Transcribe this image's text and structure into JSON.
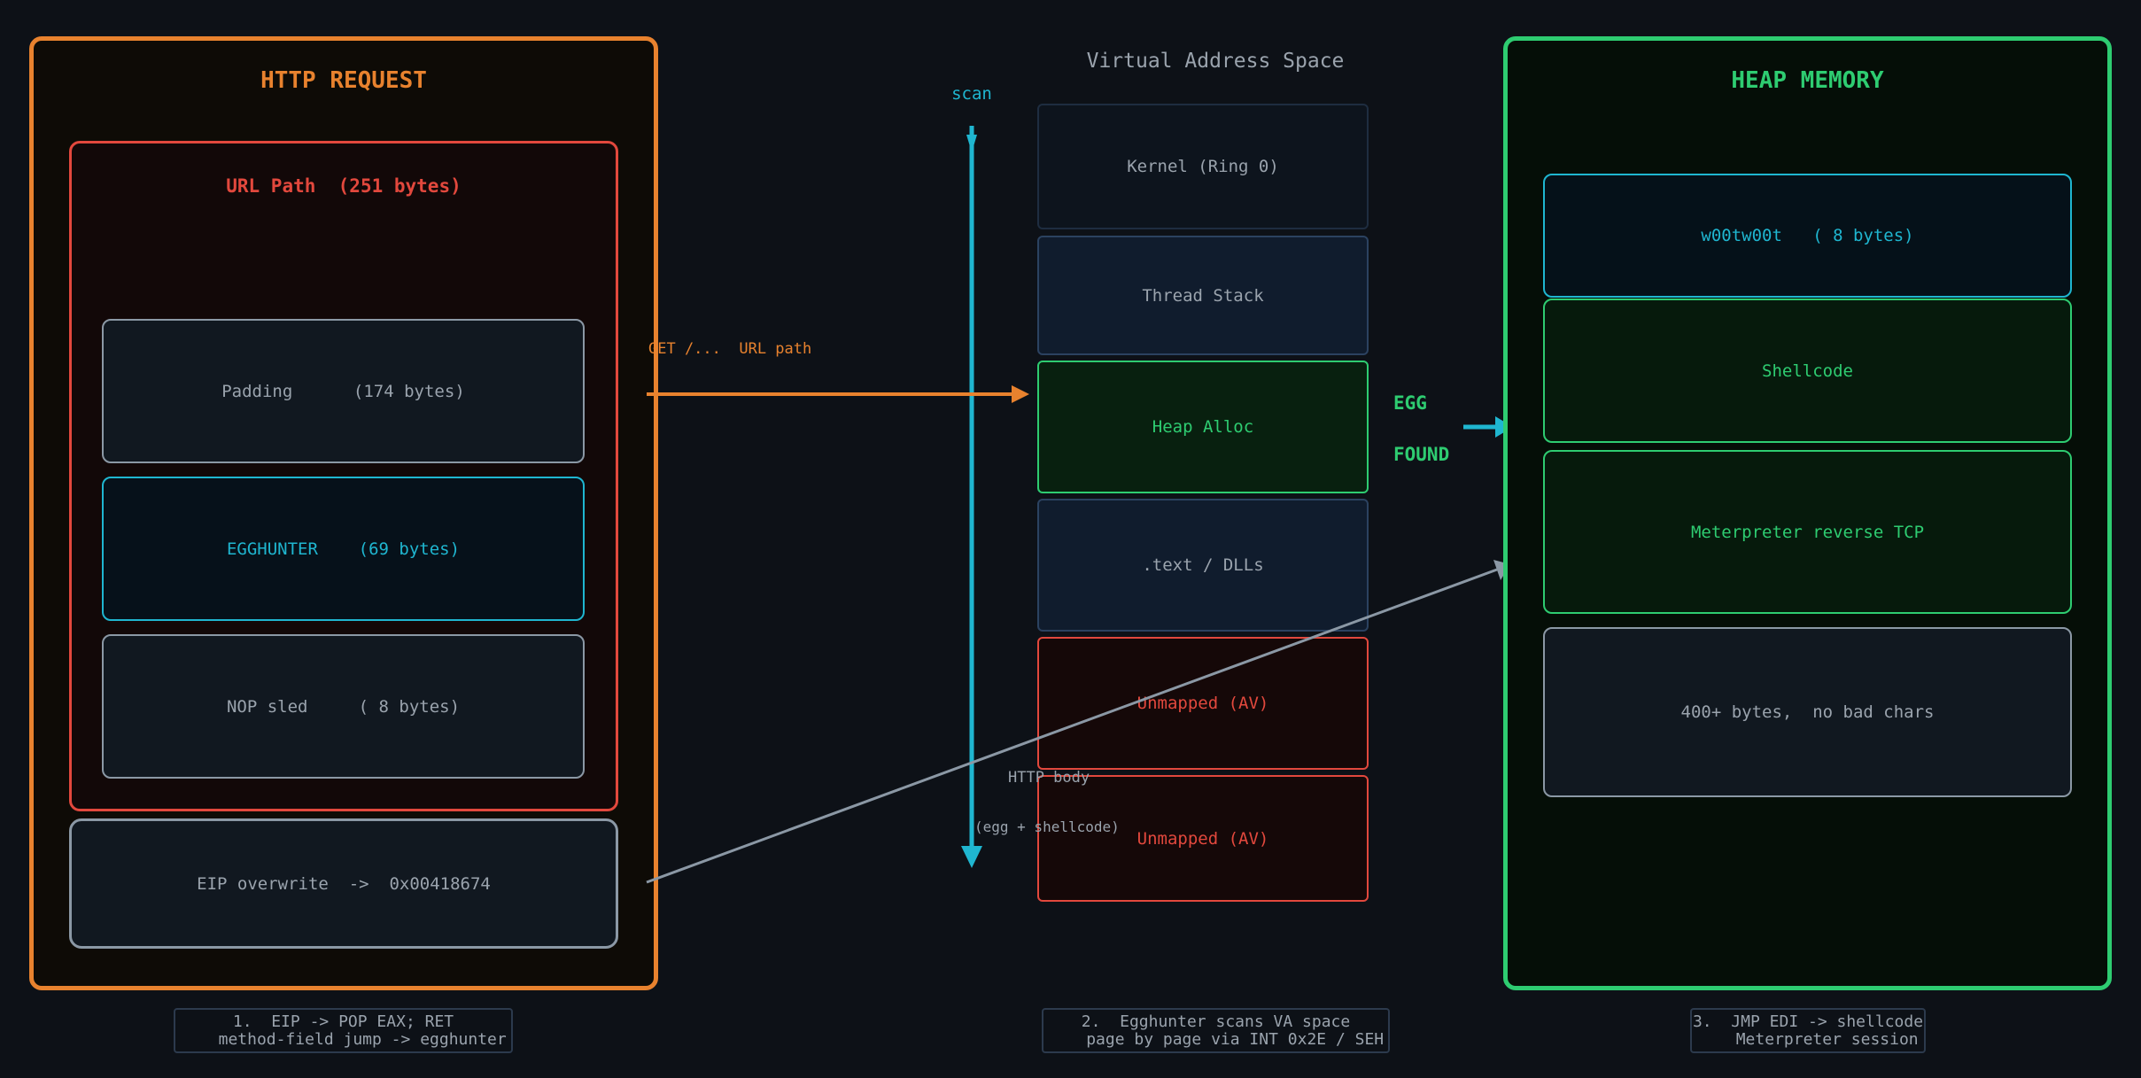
{
  "left_panel": {
    "title": "HTTP REQUEST",
    "url_path": {
      "title": "URL Path  (251 bytes)",
      "segments": [
        "Padding      (174 bytes)",
        "EGGHUNTER    (69 bytes)",
        "NOP sled     ( 8 bytes)"
      ]
    },
    "eip": "EIP overwrite  ->  0x00418674",
    "caption": "1.  EIP -> POP EAX; RET\n    method-field jump -> egghunter"
  },
  "middle": {
    "title": "Virtual Address Space",
    "scan_label": "scan",
    "regions": [
      "Kernel (Ring 0)",
      "Thread Stack",
      "Heap Alloc",
      ".text / DLLs",
      "Unmapped (AV)",
      "Unmapped (AV)"
    ],
    "get_label": "GET /...  URL path",
    "http_body_label": "HTTP body",
    "egg_shellcode_label": "(egg + shellcode)",
    "egg_label": "EGG",
    "found_label": "FOUND",
    "caption": "2.  Egghunter scans VA space\n    page by page via INT 0x2E / SEH"
  },
  "right_panel": {
    "title": "HEAP MEMORY",
    "blocks": [
      "w00tw00t   ( 8 bytes)",
      "Shellcode",
      "Meterpreter reverse TCP",
      "400+ bytes,  no bad chars"
    ],
    "caption": "3.  JMP EDI -> shellcode\n    Meterpreter session"
  },
  "colors": {
    "background": "#0d1117",
    "orange": "#e8822e",
    "red": "#e2483d",
    "cyan": "#1fb6d0",
    "green": "#2ecc71",
    "gray": "#8b98a5",
    "text_gray": "#9aa3ad"
  }
}
